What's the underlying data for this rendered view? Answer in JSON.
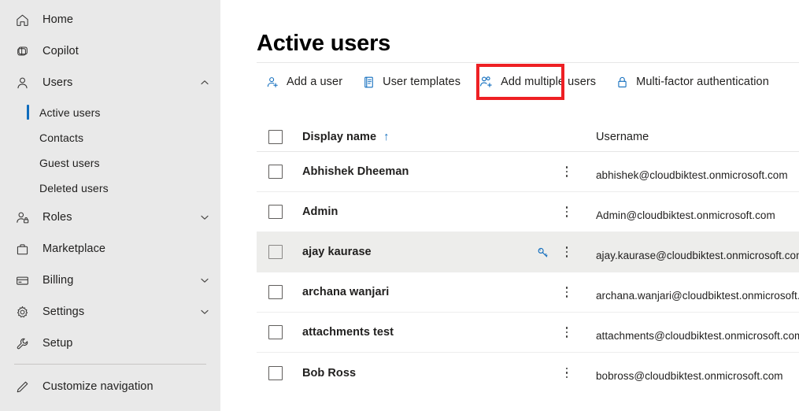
{
  "sidebar": {
    "items": [
      {
        "label": "Home",
        "icon": "home-icon",
        "expandable": false
      },
      {
        "label": "Copilot",
        "icon": "copilot-icon",
        "expandable": false
      },
      {
        "label": "Users",
        "icon": "user-icon",
        "expandable": true,
        "expanded": true
      }
    ],
    "user_subitems": [
      {
        "label": "Active users",
        "selected": true
      },
      {
        "label": "Contacts",
        "selected": false
      },
      {
        "label": "Guest users",
        "selected": false
      },
      {
        "label": "Deleted users",
        "selected": false
      }
    ],
    "items_after": [
      {
        "label": "Roles",
        "icon": "roles-icon",
        "expandable": true
      },
      {
        "label": "Marketplace",
        "icon": "marketplace-icon",
        "expandable": false
      },
      {
        "label": "Billing",
        "icon": "billing-icon",
        "expandable": true
      },
      {
        "label": "Settings",
        "icon": "gear-icon",
        "expandable": true
      },
      {
        "label": "Setup",
        "icon": "wrench-icon",
        "expandable": false
      }
    ],
    "customize": {
      "label": "Customize navigation",
      "icon": "pencil-icon"
    }
  },
  "page": {
    "title": "Active users"
  },
  "toolbar": {
    "commands": [
      {
        "label": "Add a user",
        "icon": "add-user-icon",
        "highlighted": true
      },
      {
        "label": "User templates",
        "icon": "templates-icon",
        "highlighted": false
      },
      {
        "label": "Add multiple users",
        "icon": "add-multiple-users-icon",
        "highlighted": false
      },
      {
        "label": "Multi-factor authentication",
        "icon": "lock-icon",
        "highlighted": false
      }
    ]
  },
  "table": {
    "columns": {
      "display_name": "Display name",
      "username": "Username"
    },
    "sort": {
      "column": "Display name",
      "direction": "ascending",
      "glyph": "↑"
    },
    "rows": [
      {
        "display_name": "Abhishek Dheeman",
        "username": "abhishek@cloudbiktest.onmicrosoft.com",
        "checked": false,
        "hovered": false
      },
      {
        "display_name": "Admin",
        "username": "Admin@cloudbiktest.onmicrosoft.com",
        "checked": false,
        "hovered": false
      },
      {
        "display_name": "ajay kaurase",
        "username": "ajay.kaurase@cloudbiktest.onmicrosoft.com",
        "checked": false,
        "hovered": true
      },
      {
        "display_name": "archana wanjari",
        "username": "archana.wanjari@cloudbiktest.onmicrosoft.com",
        "checked": false,
        "hovered": false
      },
      {
        "display_name": "attachments test",
        "username": "attachments@cloudbiktest.onmicrosoft.com",
        "checked": false,
        "hovered": false
      },
      {
        "display_name": "Bob Ross",
        "username": "bobross@cloudbiktest.onmicrosoft.com",
        "checked": false,
        "hovered": false
      }
    ]
  },
  "colors": {
    "accent": "#0f6cbd",
    "highlight_box": "#ee2024",
    "sidebar_bg": "#e9e9e9",
    "row_hover_bg": "#ededeb",
    "text": "#201f1e"
  }
}
